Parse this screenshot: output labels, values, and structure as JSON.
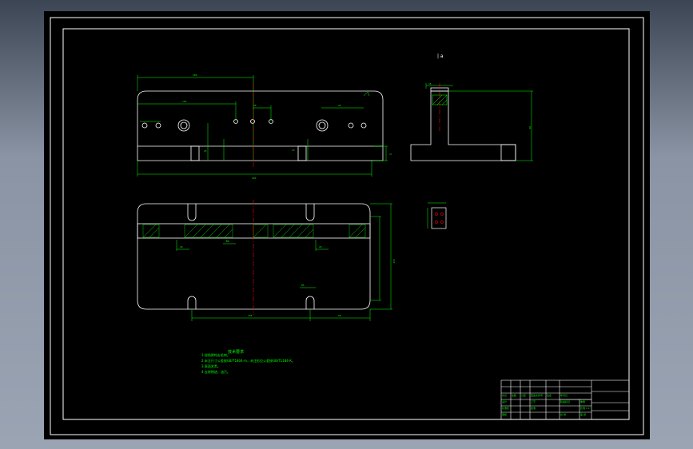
{
  "section_view_label": "| a",
  "notes": {
    "title": "技术要求",
    "lines": [
      "1.锐角倒钝去毛刺。",
      "2.未注尺寸公差按GB/T1804-m，未注形位公差按GB/T1184-K。",
      "3.表面发黑。",
      "4.去除锈迹，油污。"
    ]
  },
  "title_block": {
    "row_labels": [
      "标记",
      "处数",
      "分区",
      "更改文件号",
      "签名",
      "年月日"
    ],
    "bottom_labels": [
      "设计",
      "标准化",
      "审核",
      "工艺",
      "批准"
    ],
    "right_labels": [
      "阶段标记",
      "重量",
      "比例",
      "共 张",
      "第 张"
    ],
    "scale_value": "1:1"
  },
  "colors": {
    "background": "#000000",
    "outline": "#ffffff",
    "dimension": "#00ff00",
    "centerline": "#ff0000",
    "hatch": "#00ff00"
  }
}
